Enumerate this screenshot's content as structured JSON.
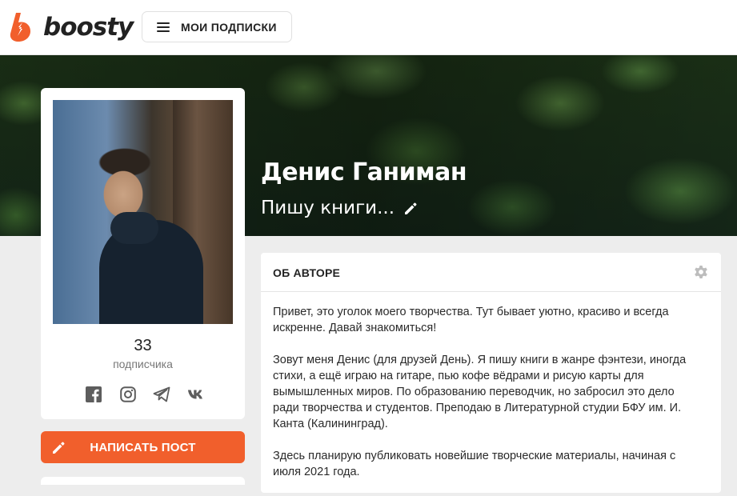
{
  "brand": {
    "name": "boosty",
    "accent": "#f15f2c"
  },
  "header": {
    "subscriptions_label": "МОИ ПОДПИСКИ"
  },
  "profile": {
    "name": "Денис Ганиман",
    "status": "Пишу книги...",
    "subscribers_count": "33",
    "subscribers_word": "подписчика",
    "socials": [
      "facebook-icon",
      "instagram-icon",
      "telegram-icon",
      "vk-icon"
    ]
  },
  "actions": {
    "write_post_label": "НАПИСАТЬ ПОСТ"
  },
  "about": {
    "title": "ОБ АВТОРЕ",
    "paragraphs": [
      "Привет, это уголок моего творчества. Тут бывает уютно, красиво и всегда искренне. Давай знакомиться!",
      "Зовут меня Денис (для друзей День). Я пишу книги в жанре фэнтези, иногда стихи, а ещё играю на гитаре, пью кофе вёдрами и рисую карты для вымышленных миров. По образованию переводчик, но забросил это дело ради творчества и студентов. Преподаю в Литературной студии БФУ им. И. Канта (Калининград).",
      "Здесь планирую публиковать новейшие творческие материалы, начиная с июля 2021 года."
    ]
  }
}
